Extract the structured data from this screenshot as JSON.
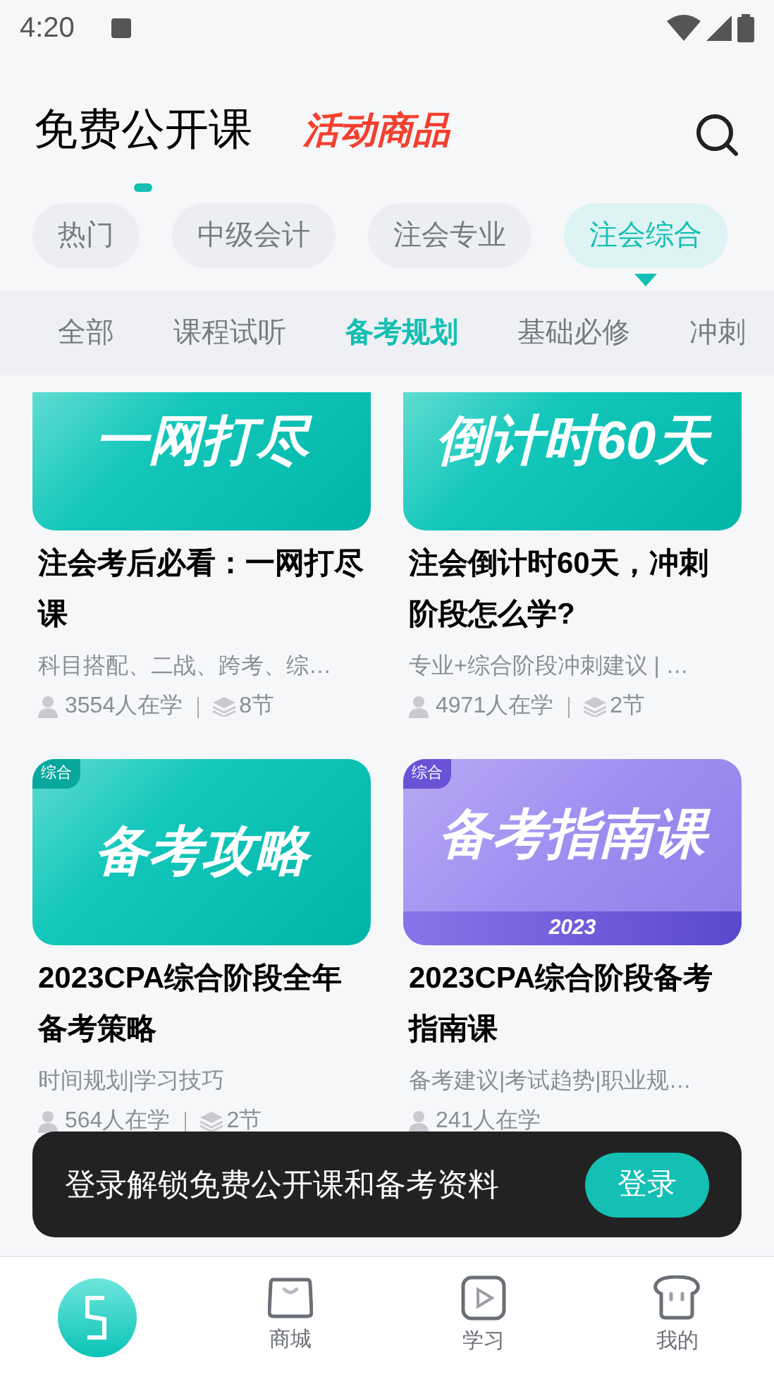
{
  "status_bar": {
    "time": "4:20"
  },
  "header": {
    "tabs": [
      {
        "label": "免费公开课",
        "selected": true
      },
      {
        "label": "活动商品",
        "selected": false
      }
    ]
  },
  "categories": [
    {
      "label": "热门",
      "selected": false
    },
    {
      "label": "中级会计",
      "selected": false
    },
    {
      "label": "注会专业",
      "selected": false
    },
    {
      "label": "注会综合",
      "selected": true
    }
  ],
  "subtabs": [
    {
      "label": "全部",
      "selected": false
    },
    {
      "label": "课程试听",
      "selected": false
    },
    {
      "label": "备考规划",
      "selected": true
    },
    {
      "label": "基础必修",
      "selected": false
    },
    {
      "label": "冲刺",
      "selected": false
    }
  ],
  "courses": [
    {
      "cover_text": "一网打尽",
      "kind": "teal",
      "title": "注会考后必看：一网打尽课",
      "subtitle": "科目搭配、二战、跨考、综…",
      "learners": "3554人在学",
      "lessons": "8节"
    },
    {
      "cover_text": "倒计时60天",
      "kind": "teal",
      "title": "注会倒计时60天，冲刺阶段怎么学?",
      "subtitle": "专业+综合阶段冲刺建议 | …",
      "learners": "4971人在学",
      "lessons": "2节"
    },
    {
      "badge": "综合",
      "cover_text": "备考攻略",
      "kind": "teal",
      "title": "2023CPA综合阶段全年备考策略",
      "subtitle": "时间规划|学习技巧",
      "learners": "564人在学",
      "lessons": "2节"
    },
    {
      "badge": "综合",
      "cover_text": "备考指南课",
      "cover_year": "2023",
      "kind": "purple",
      "title": "2023CPA综合阶段备考指南课",
      "subtitle": "备考建议|考试趋势|职业规…",
      "learners": "241人在学"
    }
  ],
  "login_toast": {
    "message": "登录解锁免费公开课和备考资料",
    "button": "登录"
  },
  "bottom_nav": [
    {
      "kind": "logo",
      "selected": true
    },
    {
      "kind": "bag",
      "label": "商城",
      "selected": false
    },
    {
      "kind": "play",
      "label": "学习",
      "selected": false
    },
    {
      "kind": "toast",
      "label": "我的",
      "selected": false
    }
  ]
}
